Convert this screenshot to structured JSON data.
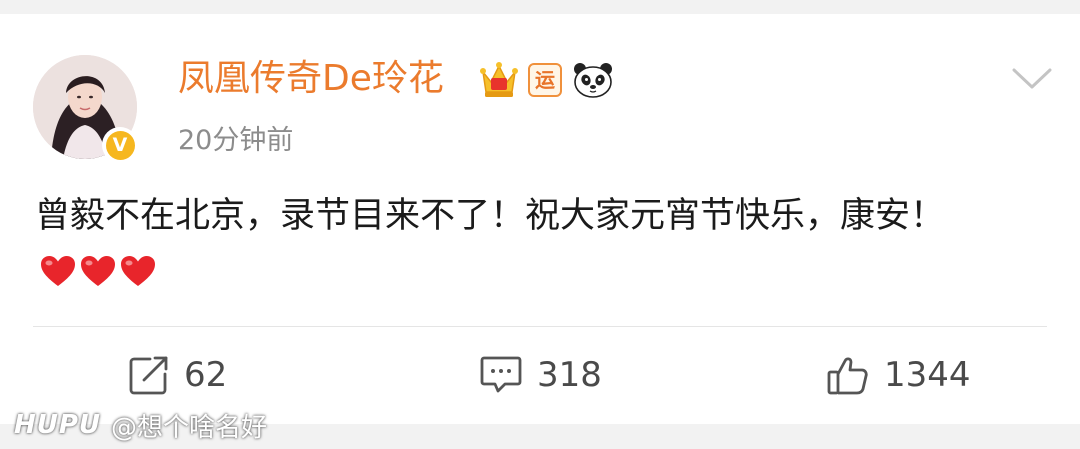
{
  "post": {
    "username": "凤凰传奇De玲花",
    "timestamp": "20分钟前",
    "text": "曾毅不在北京，录节目来不了！祝大家元宵节快乐，康安！",
    "badges": [
      "crown-icon",
      "yun-badge-icon",
      "panda-icon"
    ],
    "yun_badge_text": "运",
    "verified_mark": "V",
    "hearts": [
      "heart-emoji",
      "heart-emoji",
      "heart-emoji"
    ]
  },
  "actions": {
    "repost": {
      "icon": "repost-icon",
      "count": "62"
    },
    "comment": {
      "icon": "comment-icon",
      "count": "318"
    },
    "like": {
      "icon": "like-icon",
      "count": "1344"
    }
  },
  "watermark": {
    "brand": "HUPU",
    "handle": "@想个啥名好"
  },
  "colors": {
    "username": "#eb7b2d",
    "timestamp": "#8c8c8c",
    "verified": "#f6b71f",
    "heart": "#e8252b",
    "background": "#f2f2f2"
  }
}
